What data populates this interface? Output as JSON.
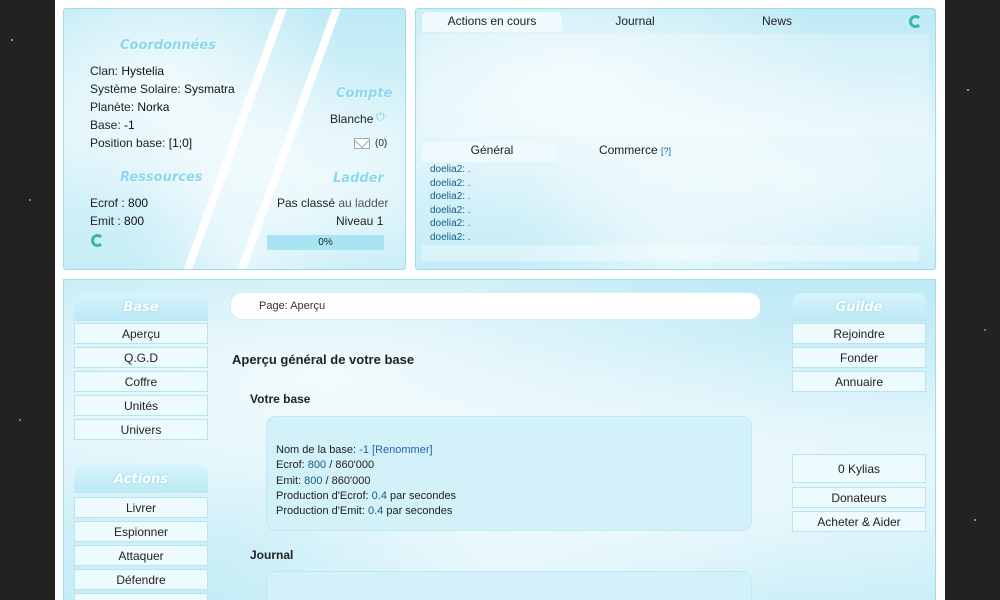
{
  "coordinates": {
    "title": "Coordonnées",
    "rows": [
      {
        "label": "Clan:",
        "value": "Hystelia"
      },
      {
        "label": "Système Solaire:",
        "value": "Sysmatra"
      },
      {
        "label": "Planète:",
        "value": "Norka"
      },
      {
        "label": "Base:",
        "value": "-1"
      },
      {
        "label": "Position base:",
        "value": "[1;0]"
      }
    ]
  },
  "resources": {
    "title": "Ressources",
    "rows": [
      {
        "label": "Ecrof :",
        "value": "800"
      },
      {
        "label": "Emit :",
        "value": "800"
      }
    ]
  },
  "account": {
    "title": "Compte",
    "name": "Blanche",
    "mail_count": "(0)"
  },
  "ladder": {
    "title": "Ladder",
    "status_a": "Pas classé",
    "status_b": "au ladder",
    "level": "Niveau 1",
    "progress_label": "0%",
    "progress_value": 0
  },
  "top_tabs": [
    "Actions en cours",
    "Journal",
    "News"
  ],
  "chat": {
    "tabs": [
      "Général",
      "Commerce"
    ],
    "commerce_help": "[?]",
    "lines": [
      "doelia2: .",
      "doelia2: .",
      "doelia2: .",
      "doelia2: .",
      "doelia2: .",
      "doelia2: ."
    ]
  },
  "left_menu": {
    "base_title": "Base",
    "base_items": [
      "Aperçu",
      "Q.G.D",
      "Coffre",
      "Unités",
      "Univers"
    ],
    "actions_title": "Actions",
    "actions_items": [
      "Livrer",
      "Espionner",
      "Attaquer",
      "Défendre"
    ]
  },
  "right_menu": {
    "guild_title": "Guilde",
    "guild_items": [
      "Rejoindre",
      "Fonder",
      "Annuaire"
    ],
    "shop_items": [
      "0 Kylias",
      "Donateurs",
      "Acheter & Aider"
    ]
  },
  "breadcrumb": {
    "prefix": "Page:",
    "page": "Aperçu"
  },
  "main": {
    "heading": "Aperçu général de votre base",
    "section_base": "Votre base",
    "base_name_label": "Nom de la base:",
    "base_name_value": "-1",
    "rename_link": "[Renommer]",
    "ecrof_label": "Ecrof:",
    "ecrof_value": "800",
    "ecrof_max": "/ 860'000",
    "emit_label": "Emit:",
    "emit_value": "800",
    "emit_max": "/ 860'000",
    "prod_ecrof_label": "Production d'Ecrof:",
    "prod_ecrof_value": "0.4",
    "prod_ecrof_unit": "par secondes",
    "prod_emit_label": "Production d'Emit:",
    "prod_emit_value": "0.4",
    "prod_emit_unit": "par secondes",
    "section_journal": "Journal"
  },
  "icons": {
    "refresh": "refresh-icon",
    "power": "power-icon",
    "mail": "mail-icon"
  },
  "colors": {
    "panel": "#c6edf7",
    "border": "#9fdcec",
    "link": "#1f62b5",
    "accent": "#3bb7a6"
  }
}
